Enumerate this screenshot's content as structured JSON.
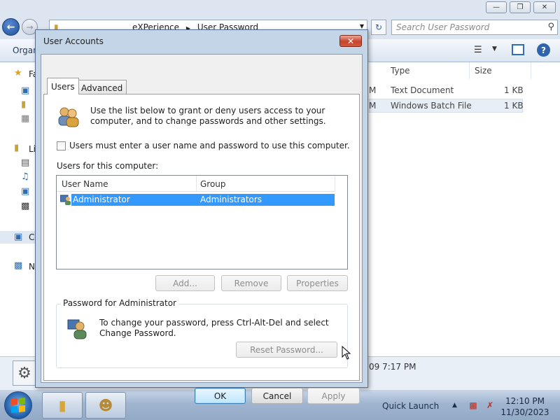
{
  "explorer": {
    "address_segments": [
      "eXPerience",
      "User Password"
    ],
    "search_placeholder": "Search User Password",
    "organize_label": "Organ",
    "nav_items": [
      "Fa",
      "Li",
      "C",
      "N"
    ],
    "columns": {
      "type": "Type",
      "size": "Size"
    },
    "files": [
      {
        "prefix": "M",
        "type": "Text Document",
        "size": "1 KB"
      },
      {
        "prefix": "M",
        "type": "Windows Batch File",
        "size": "1 KB"
      }
    ],
    "details_date": "09 7:17 PM"
  },
  "dialog": {
    "title": "User Accounts",
    "tabs": [
      "Users",
      "Advanced"
    ],
    "intro": "Use the list below to grant or deny users access to your computer, and to change passwords and other settings.",
    "checkbox_label": "Users must enter a user name and password to use this computer.",
    "checkbox_checked": false,
    "users_label": "Users for this computer:",
    "list_columns": [
      "User Name",
      "Group"
    ],
    "users": [
      {
        "name": "Administrator",
        "group": "Administrators",
        "selected": true
      }
    ],
    "buttons": {
      "add": "Add...",
      "remove": "Remove",
      "properties": "Properties"
    },
    "password_group_title": "Password for Administrator",
    "password_text": "To change your password, press Ctrl-Alt-Del and select Change Password.",
    "reset_password": "Reset Password...",
    "ok": "OK",
    "cancel": "Cancel",
    "apply": "Apply"
  },
  "taskbar": {
    "quick_launch": "Quick Launch",
    "time": "12:10 PM",
    "date": "11/30/2023"
  },
  "colors": {
    "selection": "#3399ff",
    "dialog_frame": "#c5d5e8",
    "close_red": "#c7432b",
    "taskbar": "#9fb5d0"
  },
  "icons": [
    "back-arrow-icon",
    "forward-arrow-icon",
    "refresh-icon",
    "search-icon",
    "help-icon",
    "users-icon",
    "user-icon",
    "windows-logo-icon",
    "folder-icon",
    "network-icon",
    "volume-muted-icon"
  ]
}
